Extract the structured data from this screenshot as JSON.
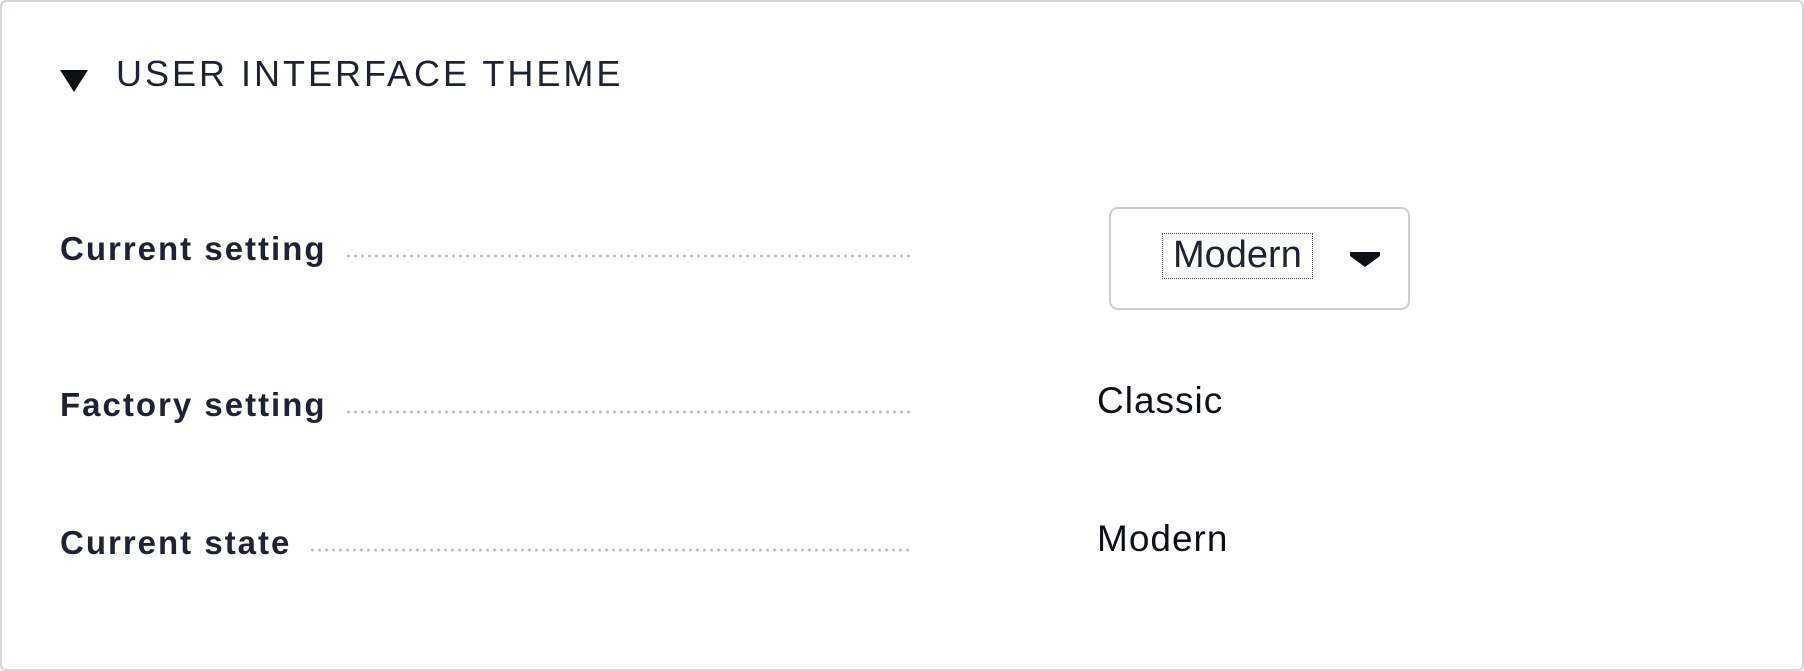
{
  "section": {
    "title": "USER INTERFACE THEME",
    "expanded": true
  },
  "rows": {
    "current_setting": {
      "label": "Current setting",
      "selected_value": "Modern"
    },
    "factory_setting": {
      "label": "Factory setting",
      "value": "Classic"
    },
    "current_state": {
      "label": "Current state",
      "value": "Modern"
    }
  },
  "icons": {
    "section_toggle": "triangle-down-icon",
    "select_caret": "caret-down-icon"
  },
  "colors": {
    "text": "#1e2235",
    "border": "#d4d6dc",
    "dots": "#b9bcc5"
  }
}
